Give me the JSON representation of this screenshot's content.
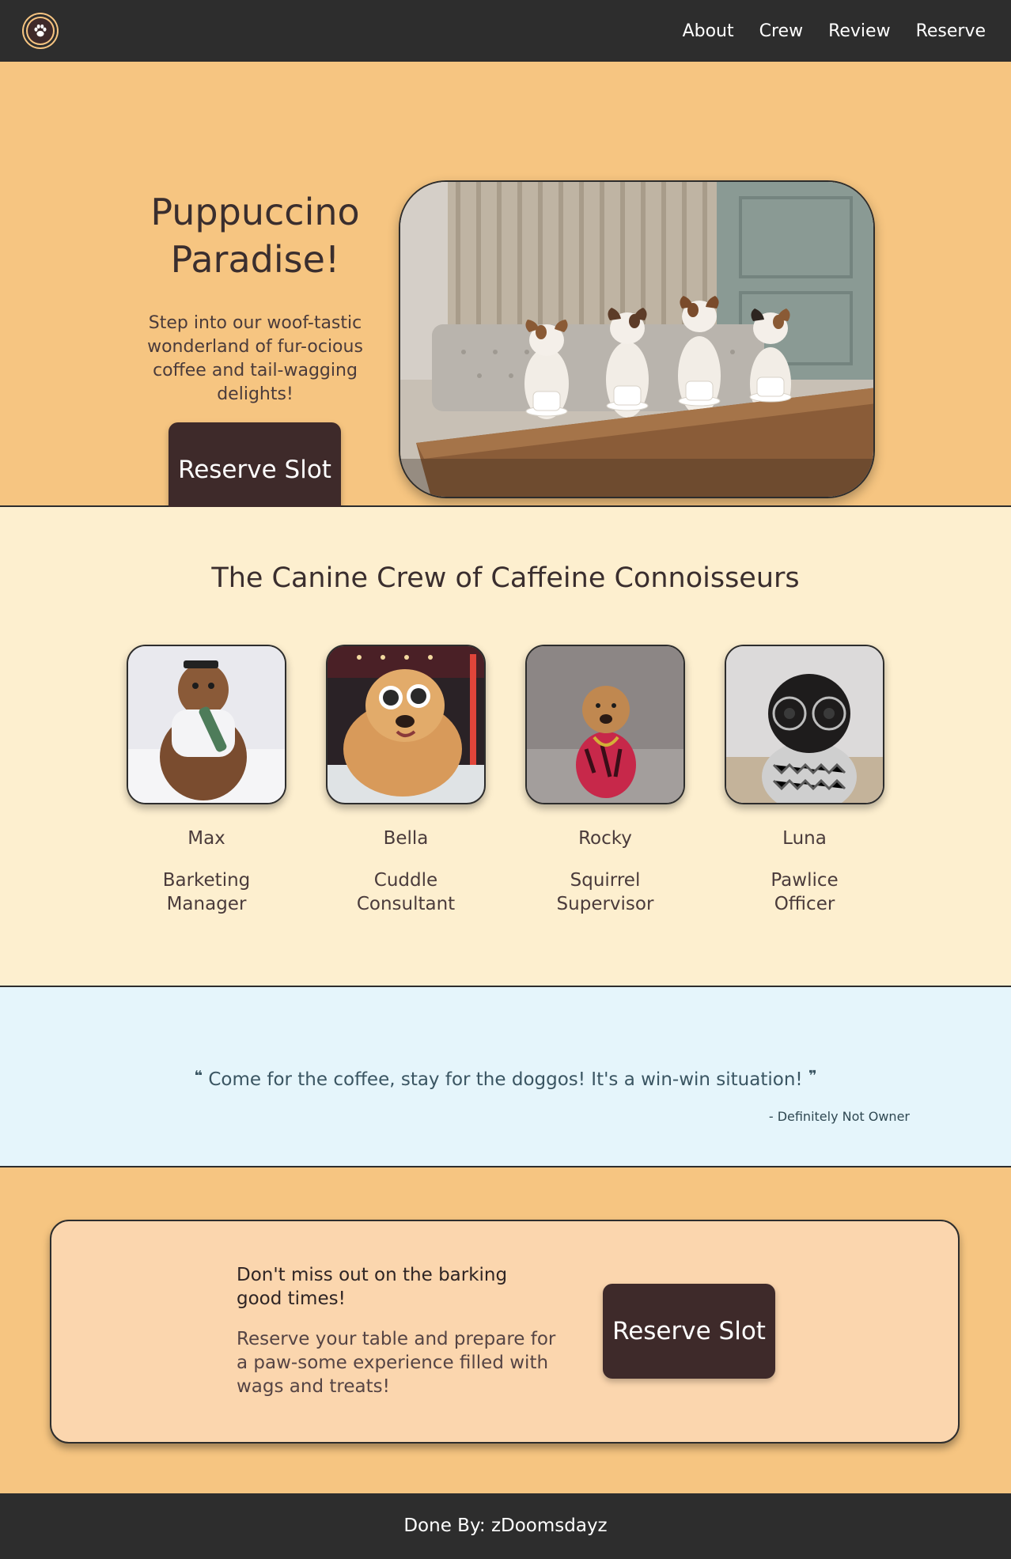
{
  "nav": {
    "logo_icon": "paw-icon",
    "links": [
      "About",
      "Crew",
      "Review",
      "Reserve"
    ]
  },
  "hero": {
    "title": "Puppuccino Paradise!",
    "subtitle": "Step into our woof-tastic wonderland of fur-ocious coffee and tail-wagging delights!",
    "button_label": "Reserve Slot"
  },
  "crew": {
    "title": "The Canine Crew of Caffeine Connoisseurs",
    "members": [
      {
        "name": "Max",
        "role": "Barketing Manager"
      },
      {
        "name": "Bella",
        "role": "Cuddle Consultant"
      },
      {
        "name": "Rocky",
        "role": "Squirrel Supervisor"
      },
      {
        "name": "Luna",
        "role": "Pawlice Officer"
      }
    ]
  },
  "review": {
    "quote": "Come for the coffee, stay for the doggos! It's a win-win situation!",
    "open_mark": "❝",
    "close_mark": "❞",
    "author": "- Definitely Not Owner"
  },
  "cta": {
    "heading": "Don't miss out on the barking good times!",
    "body": "Reserve your table and prepare for a paw-some experience filled with wags and treats!",
    "button_label": "Reserve Slot"
  },
  "footer": {
    "text": "Done By: zDoomsdayz"
  },
  "colors": {
    "nav_bg": "#2d2d2d",
    "hero_bg": "#f6c581",
    "crew_bg": "#fdefcf",
    "quote_bg": "#e5f5fb",
    "cta_card_bg": "#fbd6ae",
    "button_bg": "#3e2a2a"
  }
}
